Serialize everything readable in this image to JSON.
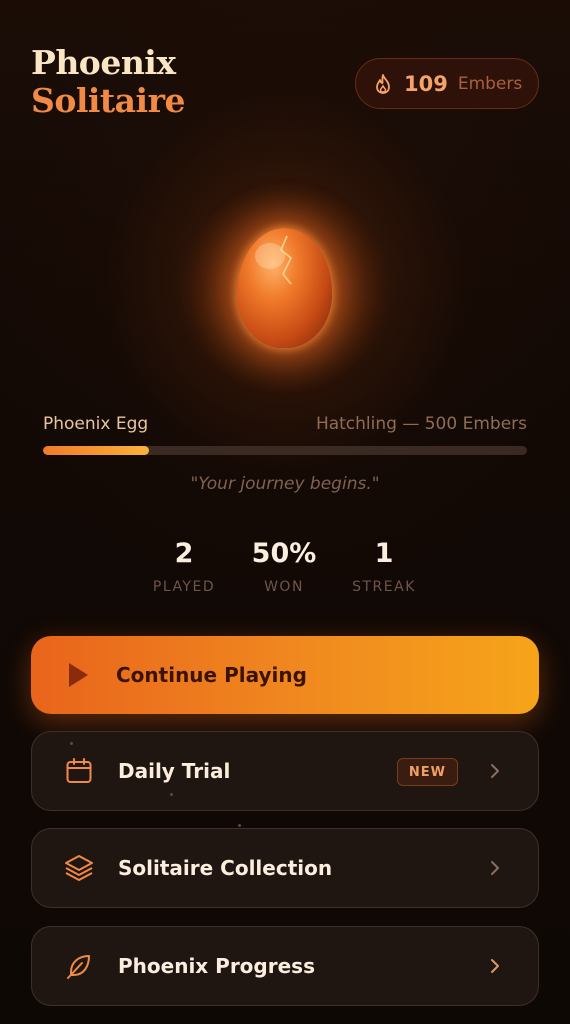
{
  "app": {
    "title_line1": "Phoenix",
    "title_line2": "Solitaire"
  },
  "embers": {
    "count": "109",
    "unit": "Embers",
    "icon": "flame-icon"
  },
  "progress": {
    "label": "Phoenix Egg",
    "next_stage": "Hatchling — 500 Embers",
    "fraction": 0.218,
    "quote": "\"Your journey begins.\""
  },
  "stats": [
    {
      "value": "2",
      "label": "PLAYED"
    },
    {
      "value": "50%",
      "label": "WON"
    },
    {
      "value": "1",
      "label": "STREAK"
    }
  ],
  "menu": {
    "continue": {
      "label": "Continue Playing",
      "icon": "play-icon"
    },
    "daily": {
      "label": "Daily Trial",
      "badge": "NEW",
      "icon": "calendar-icon"
    },
    "collection": {
      "label": "Solitaire Collection",
      "icon": "layers-icon"
    },
    "progress": {
      "label": "Phoenix Progress",
      "icon": "feather-icon"
    }
  },
  "colors": {
    "background": "#120905",
    "accent": "#f08a45",
    "title": "#fbe6c4",
    "primary_button_start": "#e9641c",
    "primary_button_end": "#f6a41a",
    "card": "#1f1612"
  }
}
